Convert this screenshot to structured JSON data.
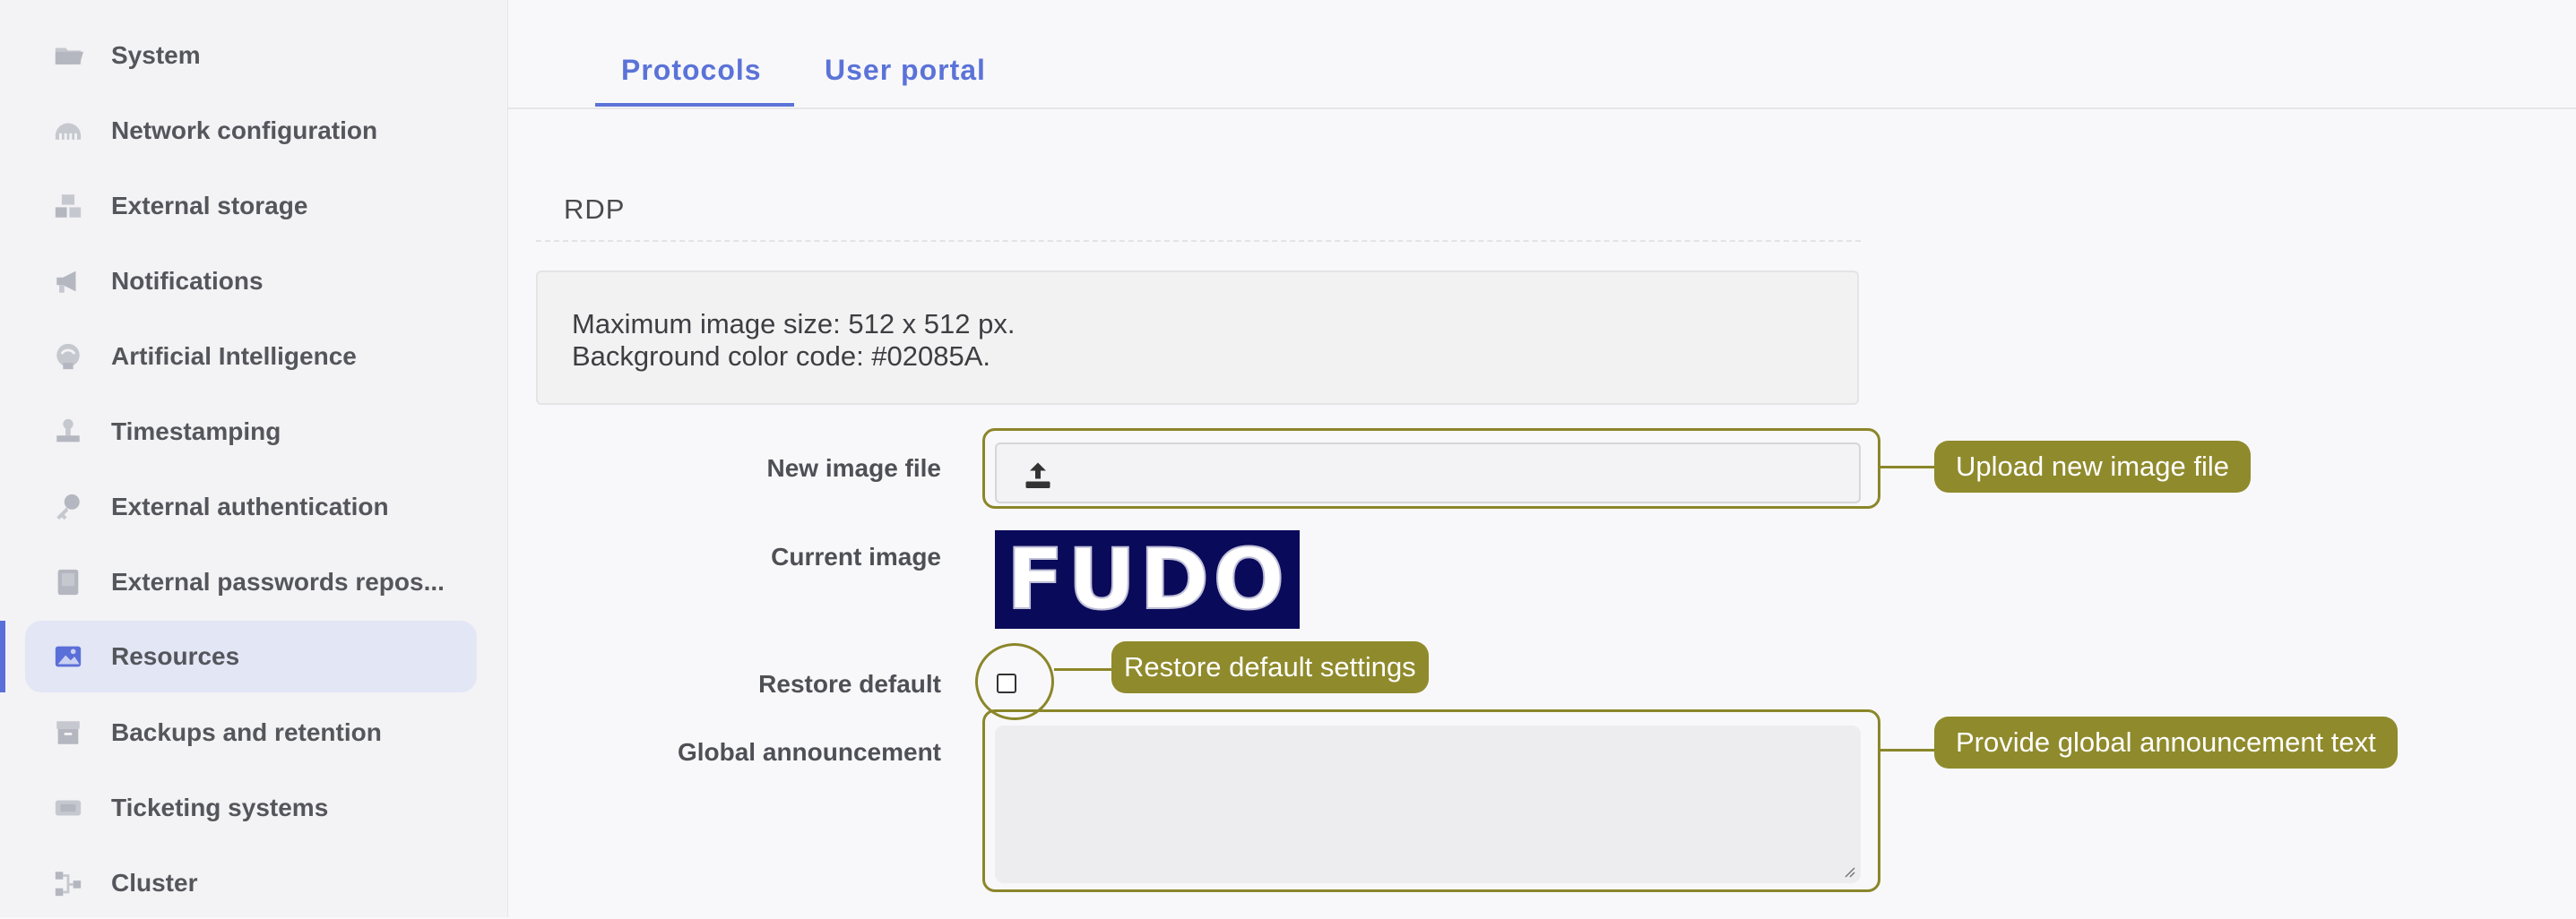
{
  "sidebar": {
    "items": [
      {
        "label": "System",
        "icon": "folder-icon"
      },
      {
        "label": "Network configuration",
        "icon": "network-icon"
      },
      {
        "label": "External storage",
        "icon": "storage-icon"
      },
      {
        "label": "Notifications",
        "icon": "megaphone-icon"
      },
      {
        "label": "Artificial Intelligence",
        "icon": "brain-icon"
      },
      {
        "label": "Timestamping",
        "icon": "stamp-icon"
      },
      {
        "label": "External authentication",
        "icon": "key-icon"
      },
      {
        "label": "External passwords repos...",
        "icon": "vault-icon"
      },
      {
        "label": "Resources",
        "icon": "image-icon",
        "active": true
      },
      {
        "label": "Backups and retention",
        "icon": "archive-icon"
      },
      {
        "label": "Ticketing systems",
        "icon": "ticket-icon"
      },
      {
        "label": "Cluster",
        "icon": "cluster-icon"
      }
    ],
    "active_color": "#5a6fd8"
  },
  "tabs": [
    {
      "label": "Protocols",
      "active": true
    },
    {
      "label": "User portal",
      "active": false
    }
  ],
  "section": {
    "title": "RDP",
    "info_lines": [
      "Maximum image size: 512 x 512 px.",
      "Background color code: #02085A."
    ]
  },
  "form": {
    "new_image_label": "New image file",
    "current_image_label": "Current image",
    "current_image_text": "FUDO",
    "restore_default_label": "Restore default",
    "restore_default_checked": false,
    "global_announcement_label": "Global announcement",
    "global_announcement_value": ""
  },
  "annotations": {
    "upload": "Upload new image file",
    "restore": "Restore default settings",
    "announcement": "Provide global announcement text",
    "color": "#8f8a2c"
  }
}
